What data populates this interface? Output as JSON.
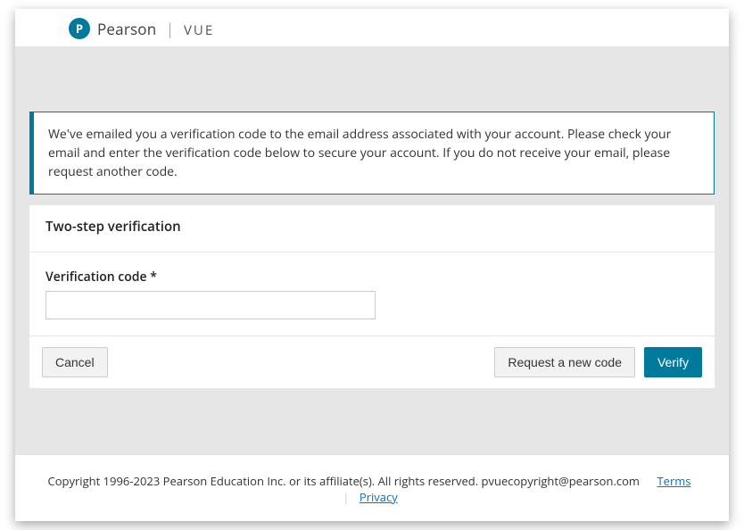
{
  "brand": {
    "initial": "P",
    "name_primary": "Pearson",
    "name_secondary": "VUE"
  },
  "notice": {
    "text": "We've emailed you a verification code to the email address associated with your account. Please check your email and enter the verification code below to secure your account. If you do not receive your email, please request another code."
  },
  "panel": {
    "title": "Two-step verification",
    "field_label": "Verification code *",
    "input_value": ""
  },
  "actions": {
    "cancel": "Cancel",
    "request_new": "Request a new code",
    "verify": "Verify"
  },
  "footer": {
    "copyright": "Copyright 1996-2023 Pearson Education Inc. or its affiliate(s). All rights reserved. pvuecopyright@pearson.com",
    "terms": "Terms",
    "privacy": "Privacy"
  }
}
